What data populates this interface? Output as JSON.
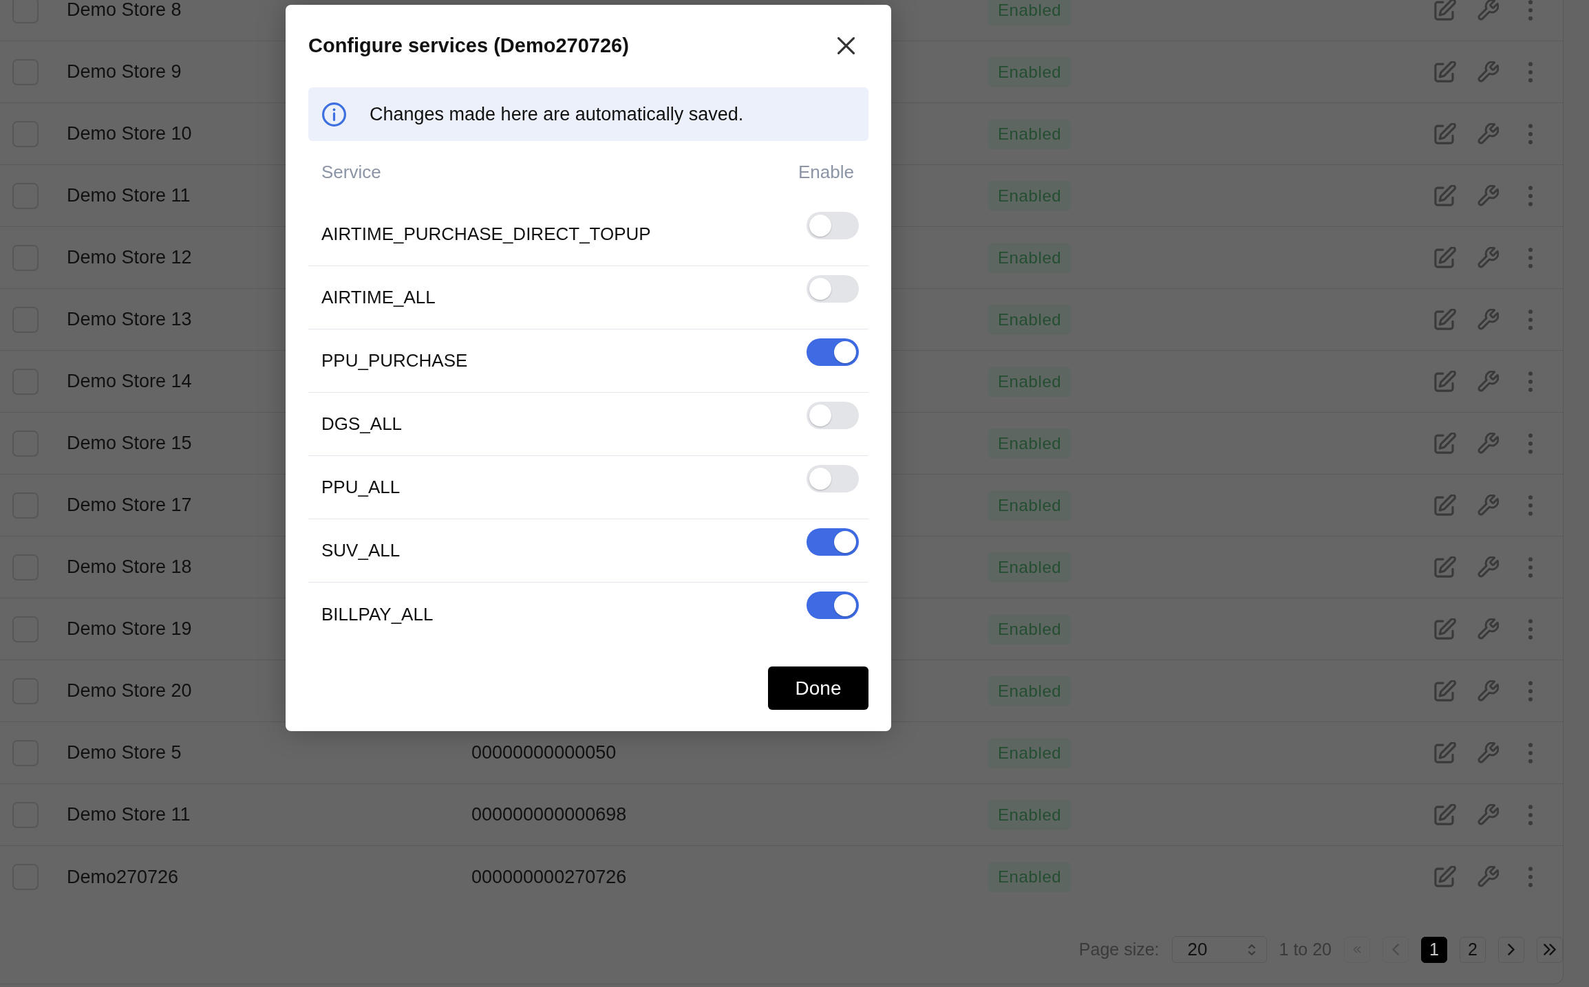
{
  "table": {
    "rows": [
      {
        "checked": false,
        "name": "Demo Store 8",
        "status": "Enabled"
      },
      {
        "checked": false,
        "name": "Demo Store 9",
        "status": "Enabled"
      },
      {
        "checked": false,
        "name": "Demo Store 10",
        "status": "Enabled"
      },
      {
        "checked": false,
        "name": "Demo Store 11",
        "status": "Enabled"
      },
      {
        "checked": false,
        "name": "Demo Store 12",
        "status": "Enabled"
      },
      {
        "checked": false,
        "name": "Demo Store 13",
        "status": "Enabled"
      },
      {
        "checked": false,
        "name": "Demo Store 14",
        "status": "Enabled"
      },
      {
        "checked": false,
        "name": "Demo Store 15",
        "status": "Enabled"
      },
      {
        "checked": false,
        "name": "Demo Store 17",
        "status": "Enabled"
      },
      {
        "checked": false,
        "name": "Demo Store 18",
        "status": "Enabled"
      },
      {
        "checked": false,
        "name": "Demo Store 19",
        "status": "Enabled"
      },
      {
        "checked": false,
        "name": "Demo Store 20",
        "status": "Enabled"
      },
      {
        "checked": false,
        "name": "Demo Store 5",
        "id": "00000000000050",
        "status": "Enabled"
      },
      {
        "checked": false,
        "name": "Demo Store 11",
        "id": "000000000000698",
        "status": "Enabled"
      },
      {
        "checked": false,
        "name": "Demo270726",
        "id": "000000000270726",
        "status": "Enabled"
      }
    ]
  },
  "pagination": {
    "page_size_label": "Page size:",
    "page_size": "20",
    "range": "1 to 20",
    "first": {
      "disabled": true
    },
    "previous": {
      "disabled": true
    },
    "pages": [
      {
        "label": "1",
        "selected": true
      },
      {
        "label": "2",
        "selected": false
      }
    ],
    "next": {
      "disabled": false
    },
    "last": {
      "disabled": false
    }
  },
  "dialog": {
    "title": "Configure services (Demo270726)",
    "notice": "Changes made here are automatically saved.",
    "columns": [
      "Service",
      "Enable"
    ],
    "services": [
      {
        "name": "AIRTIME_PURCHASE_DIRECT_TOPUP",
        "on": false
      },
      {
        "name": "AIRTIME_ALL",
        "on": false
      },
      {
        "name": "PPU_PURCHASE",
        "on": true
      },
      {
        "name": "DGS_ALL",
        "on": false
      },
      {
        "name": "PPU_ALL",
        "on": false
      },
      {
        "name": "SUV_ALL",
        "on": true
      },
      {
        "name": "BILLPAY_ALL",
        "on": true
      }
    ],
    "done_button": "Done"
  }
}
